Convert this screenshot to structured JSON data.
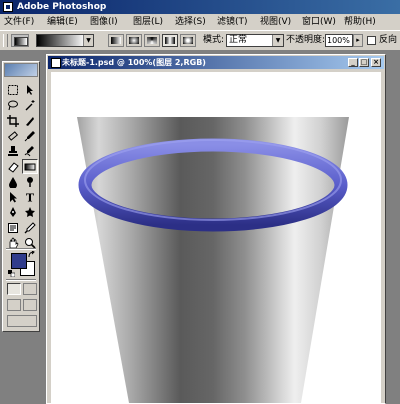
{
  "app": {
    "title": "Adobe Photoshop"
  },
  "menu": [
    {
      "label": "文件(F)"
    },
    {
      "label": "编辑(E)"
    },
    {
      "label": "图像(I)"
    },
    {
      "label": "图层(L)"
    },
    {
      "label": "选择(S)"
    },
    {
      "label": "滤镜(T)"
    },
    {
      "label": "视图(V)"
    },
    {
      "label": "窗口(W)"
    },
    {
      "label": "帮助(H)"
    }
  ],
  "options": {
    "mode_label": "模式:",
    "mode_value": "正常",
    "opacity_label": "不透明度:",
    "opacity_value": "100%",
    "reverse_label": "反向",
    "reverse_checked": false,
    "gradient_types": [
      "linear",
      "radial",
      "angle",
      "reflected",
      "diamond"
    ],
    "active_gradient_type": "reflected"
  },
  "document": {
    "title": "未标题-1.psd @ 100%(图层 2,RGB)"
  },
  "tools": [
    "marquee-tool",
    "move-tool",
    "lasso-tool",
    "magic-wand-tool",
    "crop-tool",
    "slice-tool",
    "healing-brush-tool",
    "brush-tool",
    "clone-stamp-tool",
    "history-brush-tool",
    "eraser-tool",
    "gradient-tool",
    "blur-tool",
    "dodge-tool",
    "path-selection-tool",
    "type-tool",
    "pen-tool",
    "custom-shape-tool",
    "notes-tool",
    "eyedropper-tool",
    "hand-tool",
    "zoom-tool"
  ],
  "active_tool": "gradient-tool",
  "colors": {
    "foreground": "#303c8c",
    "background": "#ffffff",
    "ring": "#5a5ecb"
  }
}
